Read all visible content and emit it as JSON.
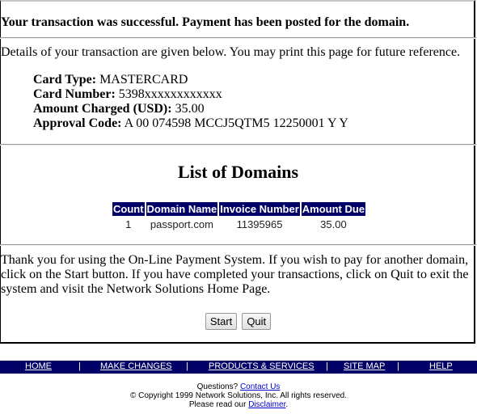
{
  "success_message": "Your transaction was successful. Payment has been posted for the domain.",
  "details_message": "Details of your transaction are given below. You may print this page for future reference.",
  "transaction": {
    "card_type_label": "Card Type:",
    "card_type": "MASTERCARD",
    "card_number_label": "Card Number:",
    "card_number": "5398xxxxxxxxxxxx",
    "amount_label": "Amount Charged (USD):",
    "amount": "35.00",
    "approval_label": "Approval Code:",
    "approval_code": "A 00 074598 MCCJ5QTM5 12250001 Y Y"
  },
  "domains": {
    "title": "List of Domains",
    "columns": [
      "Count",
      "Domain Name",
      "Invoice Number",
      "Amount Due"
    ],
    "rows": [
      [
        "1",
        "passport.com",
        "11395965",
        "35.00"
      ]
    ]
  },
  "thanks_message": "Thank you for using the On-Line Payment System. If you wish to pay for another domain, click on the Start button. If you have completed your transactions, click on Quit to exit the system and visit the Network Solutions Home Page.",
  "buttons": {
    "start": "Start",
    "quit": "Quit"
  },
  "nav": {
    "items": [
      "HOME",
      "MAKE CHANGES",
      "PRODUCTS & SERVICES",
      "SITE MAP",
      "HELP"
    ],
    "separator": "|",
    "bg_color": "#000066"
  },
  "footer": {
    "questions": "Questions?",
    "contact": "Contact Us",
    "copyright": "© Copyright 1999 Network Solutions, Inc. All rights reserved.",
    "read": "Please read our",
    "disclaimer": "Disclaimer",
    "period": "."
  }
}
